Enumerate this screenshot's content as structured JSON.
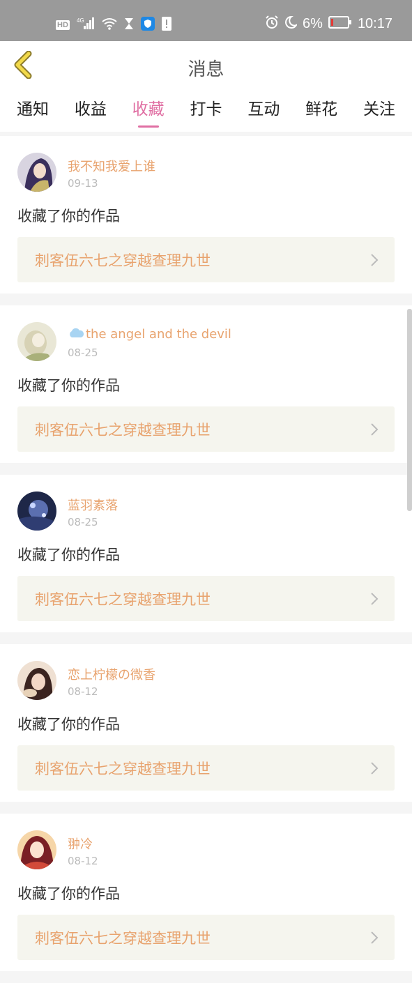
{
  "status_bar": {
    "left_badges": [
      "HD",
      "4G"
    ],
    "battery_percent": "6%",
    "time": "10:17"
  },
  "header": {
    "title": "消息"
  },
  "tabs": [
    {
      "label": "通知",
      "active": false
    },
    {
      "label": "收益",
      "active": false
    },
    {
      "label": "收藏",
      "active": true
    },
    {
      "label": "打卡",
      "active": false
    },
    {
      "label": "互动",
      "active": false
    },
    {
      "label": "鲜花",
      "active": false
    },
    {
      "label": "关注",
      "active": false
    }
  ],
  "colors": {
    "accent": "#e06fa3",
    "name": "#e8a36e",
    "status_bar": "#9a9a9a"
  },
  "items": [
    {
      "username": "我不知我爱上谁",
      "date": "09-13",
      "action": "收藏了你的作品",
      "work": "刺客伍六七之穿越查理九世",
      "avatar_icon": "avatar-purple-hair"
    },
    {
      "username": "the angel and the devil",
      "has_cloud_icon": true,
      "date": "08-25",
      "action": "收藏了你的作品",
      "work": "刺客伍六七之穿越查理九世",
      "avatar_icon": "avatar-pale"
    },
    {
      "username": "蓝羽素落",
      "date": "08-25",
      "action": "收藏了你的作品",
      "work": "刺客伍六七之穿越查理九世",
      "avatar_icon": "avatar-blue"
    },
    {
      "username": "恋上柠檬の微香",
      "date": "08-12",
      "action": "收藏了你的作品",
      "work": "刺客伍六七之穿越查理九世",
      "avatar_icon": "avatar-brown"
    },
    {
      "username": "翀冷",
      "date": "08-12",
      "action": "收藏了你的作品",
      "work": "刺客伍六七之穿越查理九世",
      "avatar_icon": "avatar-red"
    }
  ]
}
